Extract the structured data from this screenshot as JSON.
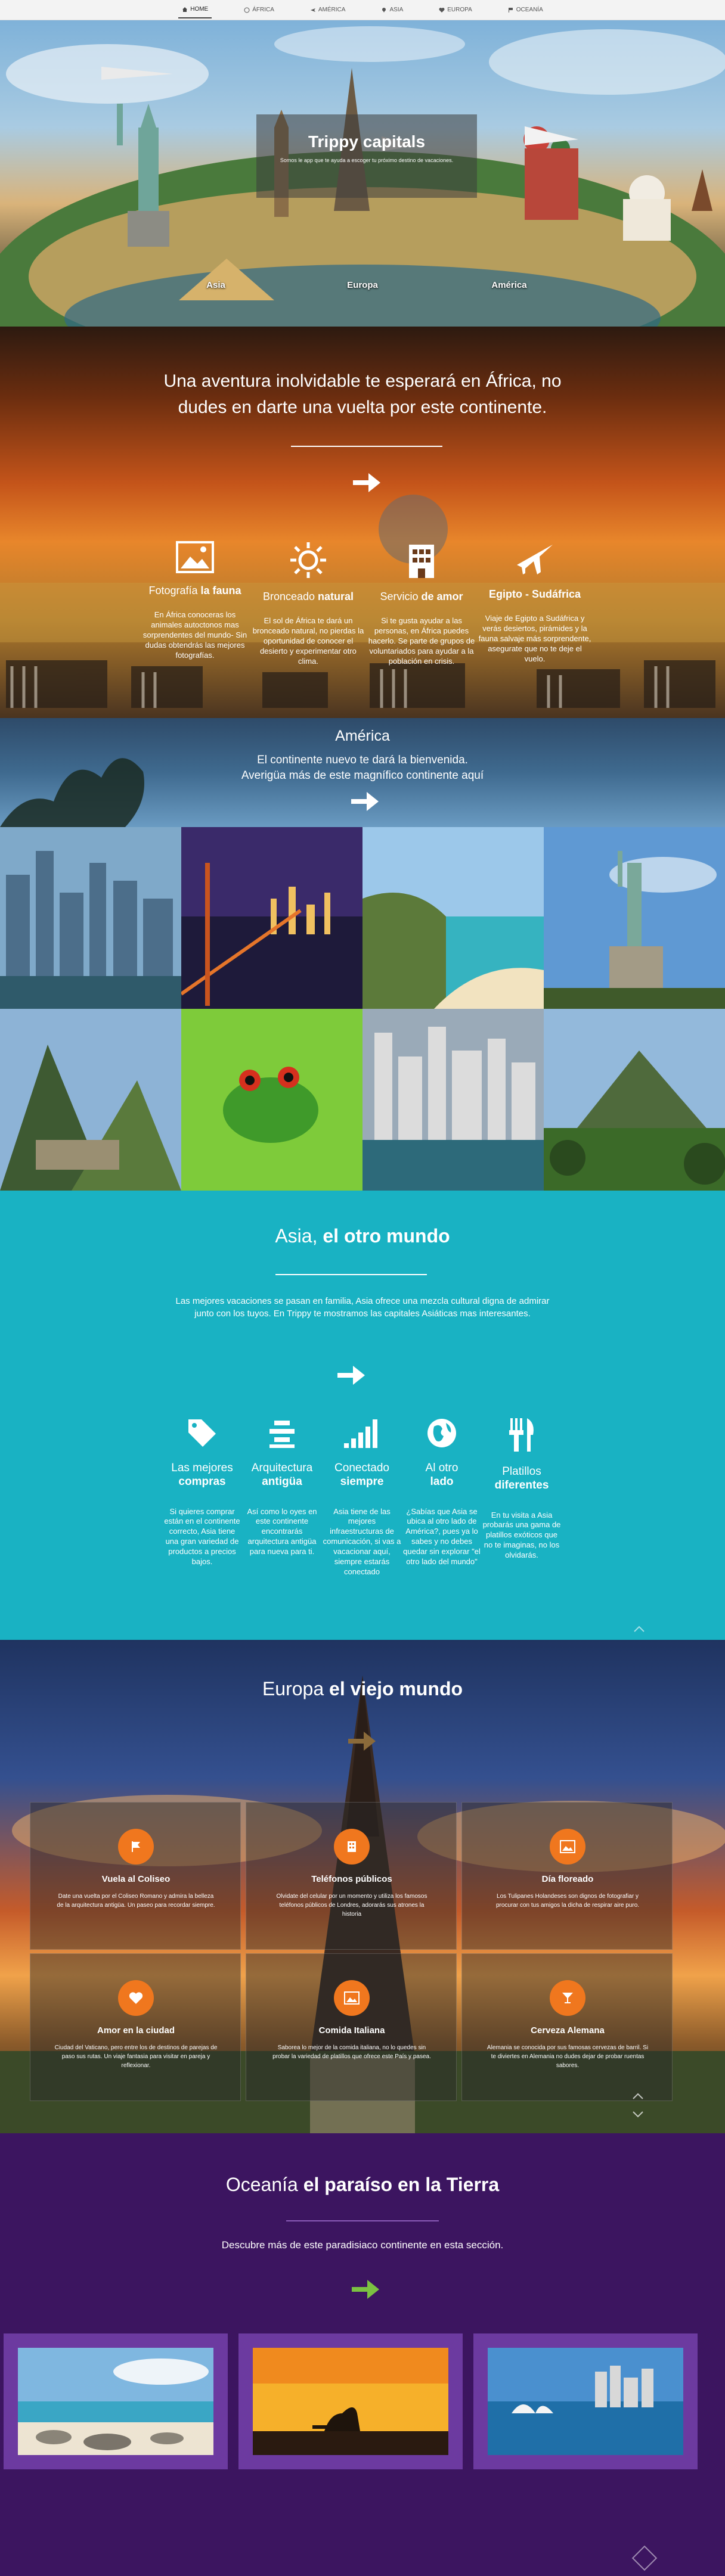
{
  "nav": {
    "items": [
      {
        "label": "HOME",
        "icon": "home-icon",
        "active": true
      },
      {
        "label": "ÁFRICA",
        "icon": "globe-icon",
        "active": false
      },
      {
        "label": "AMÉRICA",
        "icon": "plane-icon",
        "active": false
      },
      {
        "label": "ASIA",
        "icon": "pin-icon",
        "active": false
      },
      {
        "label": "EUROPA",
        "icon": "heart-icon",
        "active": false
      },
      {
        "label": "OCEANÍA",
        "icon": "flag-icon",
        "active": false
      }
    ]
  },
  "hero": {
    "title": "Trippy capitals",
    "subtitle": "Somos le app que te ayuda a escoger tu próximo destino de vacaciones.",
    "links": [
      "Asia",
      "Europa",
      "América"
    ]
  },
  "africa": {
    "lead_pre": "Una aventura inolvidable te esperará en ",
    "lead_bold": "África,",
    "lead_post": " no dudes en darte una vuelta por este continente.",
    "features": [
      {
        "icon": "image-icon",
        "title_light": "Fotografía ",
        "title_bold": "la fauna",
        "desc": "En África conoceras los animales autoctonos mas sorprendentes del mundo- Sin dudas obtendrás las mejores fotografías."
      },
      {
        "icon": "sun-icon",
        "title_light": "Bronceado ",
        "title_bold": "natural",
        "desc": "El sol de África te dará un bronceado natural, no pierdas la oportunidad de conocer el desierto y experimentar otro clima."
      },
      {
        "icon": "building-icon",
        "title_light": "Servicio ",
        "title_bold": "de amor",
        "desc": "Si te gusta ayudar a las personas, en África puedes hacerlo. Se parte de grupos de voluntariados para ayudar a la población en crisis."
      },
      {
        "icon": "plane-icon",
        "title_light": "",
        "title_bold": "Egipto - Sudáfrica",
        "desc": "Viaje de Egipto a Sudáfrica y verás desiertos, pirámides y la fauna salvaje más sorprendente, asegurate que no te deje el vuelo."
      }
    ]
  },
  "america": {
    "title": "América",
    "line1": "El continente nuevo te dará la bienvenida.",
    "line2": "Averigüa más de este magnífico continente aquí"
  },
  "asia": {
    "title_light": "Asia, ",
    "title_bold": "el otro mundo",
    "lead": "Las mejores vacaciones se pasan en familia, Asia ofrece una mezcla cultural digna de admirar junto con los tuyos. En Trippy te mostramos las capitales Asiáticas mas interesantes.",
    "features": [
      {
        "icon": "tag-icon",
        "title_light": "Las mejores",
        "title_bold": "compras",
        "desc": "Si quieres comprar están en el continente correcto, Asia tiene una gran variedad de productos a precios bajos."
      },
      {
        "icon": "layers-icon",
        "title_light": "Arquitectura",
        "title_bold": "antigüa",
        "desc": "Así como lo oyes en este continente encontrarás arquitectura antigüa para nueva para ti."
      },
      {
        "icon": "signal-icon",
        "title_light": "Conectado",
        "title_bold": "siempre",
        "desc": "Asia tiene de las mejores infraestructuras de comunicación, si vas a vacacionar aquí, siempre estarás conectado"
      },
      {
        "icon": "globe-icon",
        "title_light": "Al otro",
        "title_bold": "lado",
        "desc": "¿Sabías que Asia se ubica al otro lado de América?, pues ya lo sabes y no debes quedar sin explorar \"el otro lado del mundo\""
      },
      {
        "icon": "cutlery-icon",
        "title_light": "Platillos",
        "title_bold": "diferentes",
        "desc": "En tu visita a Asia probarás una gama de platillos exóticos que no te imaginas, no los olvidarás."
      }
    ]
  },
  "europe": {
    "title_light": "Europa ",
    "title_bold": "el viejo mundo",
    "cards": [
      {
        "icon": "flag-icon",
        "title": "Vuela al Coliseo",
        "desc": "Date una vuelta por el Coliseo Romano y admira la belleza de la arquitectura antigüa. Un paseo para recordar siempre."
      },
      {
        "icon": "building-icon",
        "title": "Teléfonos públicos",
        "desc": "Olvidate del celular por un momento y utiliza los famosos teléfonos públicos de Londres, adorarás sus atrones la historia"
      },
      {
        "icon": "image-icon",
        "title": "Día floreado",
        "desc": "Los Tulipanes Holandeses son dignos de fotografiar y procurar con tus amigos la dicha de respirar aire puro."
      },
      {
        "icon": "heart-icon",
        "title": "Amor en la ciudad",
        "desc": "Ciudad del Vaticano, pero entre los de destinos de parejas de paso sus rutas. Un viaje fantasia para visitar en pareja y reflexionar."
      },
      {
        "icon": "image-icon",
        "title": "Comida Italiana",
        "desc": "Saborea lo mejor de la comida italiana, no lo quedes sin probar la variedad de platillos que ofrece este País y pasea."
      },
      {
        "icon": "cocktail-icon",
        "title": "Cerveza Alemana",
        "desc": "Alemania se conocida por sus famosas cervezas de barril. Si te diviertes en Alemania no dudes dejar de probar ruentas sabores."
      }
    ]
  },
  "oceania": {
    "title_light": "Oceanía ",
    "title_bold": "el paraíso en la Tierra",
    "lead": "Descubre más de este paradisiaco continente en esta sección."
  },
  "colors": {
    "asia_bg": "#19b2c3",
    "oceania_bg": "#3c1560",
    "oceania_card": "#6c3aa0",
    "europe_badge": "#f0771e",
    "oceania_arrow": "#7bc142"
  }
}
